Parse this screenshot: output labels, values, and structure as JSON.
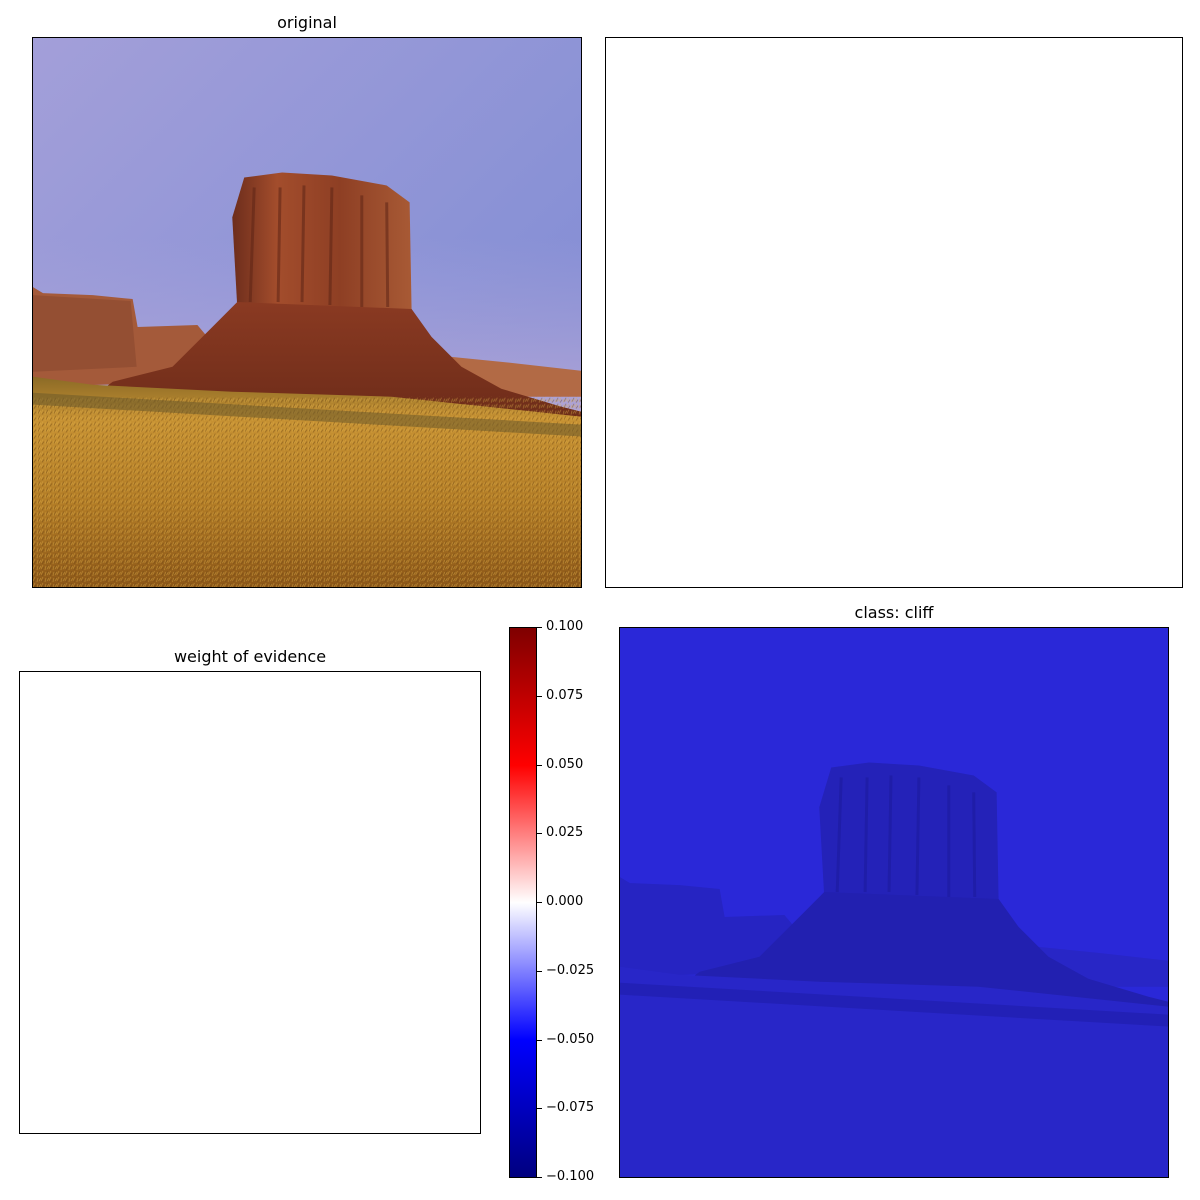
{
  "chart_data": [
    {
      "type": "image",
      "title": "original",
      "description": ""
    },
    {
      "type": "image",
      "title": ""
    },
    {
      "type": "heatmap",
      "title": "weight of evidence",
      "colorbar": {
        "colormap": "seismic",
        "vmin": -0.1,
        "vmax": 0.1,
        "ticks": [
          0.1,
          0.075,
          0.05,
          0.025,
          0.0,
          -0.025,
          -0.05,
          -0.075,
          -0.1
        ],
        "tick_labels": [
          "0.100",
          "0.075",
          "0.050",
          "0.025",
          "0.000",
          "−0.025",
          "−0.050",
          "−0.075",
          "−0.100"
        ]
      }
    },
    {
      "type": "heatmap",
      "title": "class: cliff",
      "overlay_color": "#2222dd"
    }
  ],
  "colors": {
    "sky_top": "#8a92d6",
    "sky_bottom": "#b3a8d8",
    "rock": "#8a3e24",
    "rock_light": "#b0603a",
    "grass": "#b88a2e",
    "grass_dark": "#7a5418",
    "overlay": "#2a28d8"
  }
}
